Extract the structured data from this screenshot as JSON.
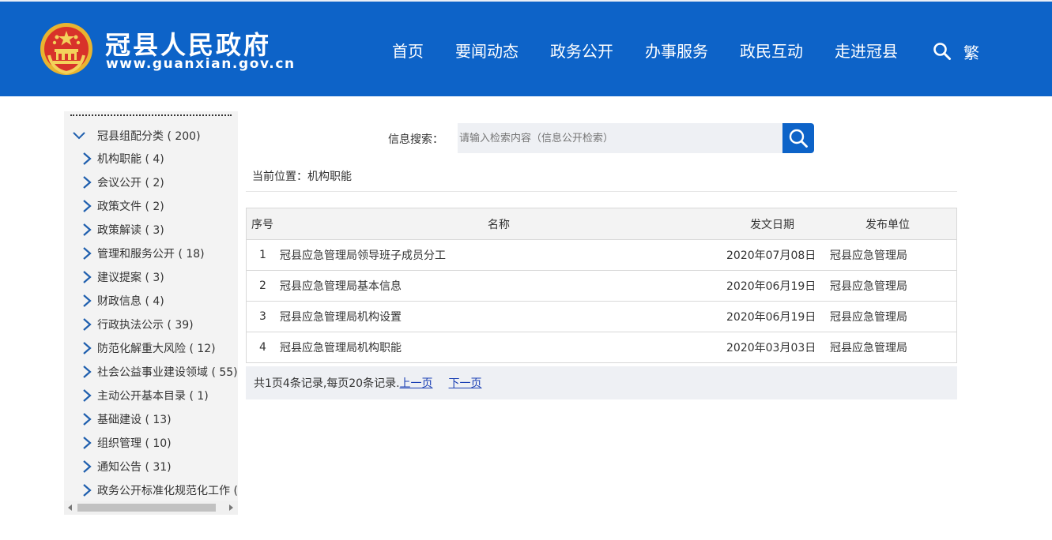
{
  "header": {
    "title": "冠县人民政府",
    "url": "www.guanxian.gov.cn",
    "nav": [
      "首页",
      "要闻动态",
      "政务公开",
      "办事服务",
      "政民互动",
      "走进冠县"
    ],
    "lang_toggle": "繁"
  },
  "colors": {
    "brand": "#0d63c8",
    "sidebar_bg": "#f3f3f3",
    "link": "#1a3fb4"
  },
  "sidebar": {
    "root": "冠县组配分类 ( 200)",
    "items": [
      "机构职能 ( 4)",
      "会议公开 ( 2)",
      "政策文件 ( 2)",
      "政策解读 ( 3)",
      "管理和服务公开 ( 18)",
      "建议提案 ( 3)",
      "财政信息 ( 4)",
      "行政执法公示 ( 39)",
      "防范化解重大风险 ( 12)",
      "社会公益事业建设领域 ( 55)",
      "主动公开基本目录 ( 1)",
      "基础建设 ( 13)",
      "组织管理 ( 10)",
      "通知公告 ( 31)",
      "政务公开标准化规范化工作 ("
    ]
  },
  "search": {
    "label": "信息搜索：",
    "placeholder": "请输入检索内容（信息公开检索）"
  },
  "breadcrumb": "当前位置：机构职能",
  "table": {
    "headers": {
      "no": "序号",
      "name": "名称",
      "date": "发文日期",
      "unit": "发布单位"
    },
    "rows": [
      {
        "no": "1",
        "name": "冠县应急管理局领导班子成员分工",
        "date": "2020年07月08日",
        "unit": "冠县应急管理局"
      },
      {
        "no": "2",
        "name": "冠县应急管理局基本信息",
        "date": "2020年06月19日",
        "unit": "冠县应急管理局"
      },
      {
        "no": "3",
        "name": "冠县应急管理局机构设置",
        "date": "2020年06月19日",
        "unit": "冠县应急管理局"
      },
      {
        "no": "4",
        "name": "冠县应急管理局机构职能",
        "date": "2020年03月03日",
        "unit": "冠县应急管理局"
      }
    ]
  },
  "pager": {
    "summary": "共1页4条记录,每页20条记录.",
    "prev": "上一页",
    "next": "下一页"
  }
}
